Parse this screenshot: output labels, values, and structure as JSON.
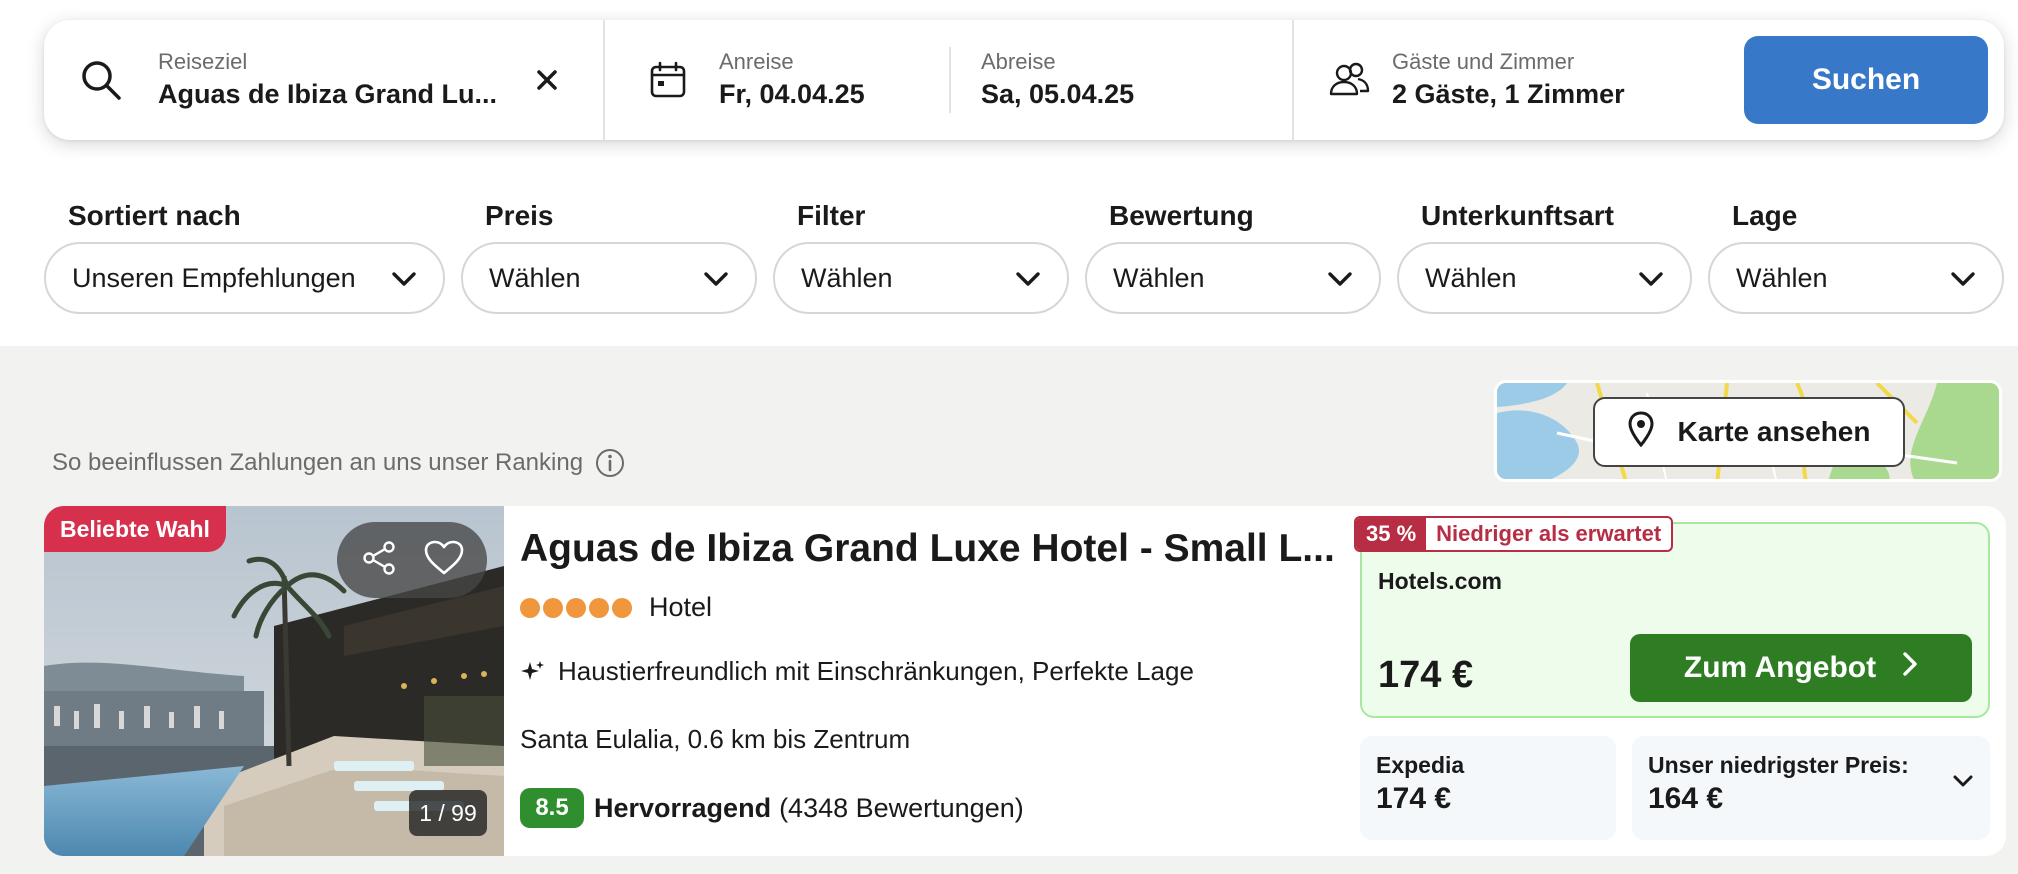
{
  "search": {
    "destination_label": "Reiseziel",
    "destination_value": "Aguas de Ibiza Grand Lu...",
    "checkin_label": "Anreise",
    "checkin_value": "Fr, 04.04.25",
    "checkout_label": "Abreise",
    "checkout_value": "Sa, 05.04.25",
    "guests_label": "Gäste und Zimmer",
    "guests_value": "2 Gäste, 1 Zimmer",
    "search_button": "Suchen"
  },
  "filters": [
    {
      "label": "Sortiert nach",
      "value": "Unseren Empfehlungen"
    },
    {
      "label": "Preis",
      "value": "Wählen"
    },
    {
      "label": "Filter",
      "value": "Wählen"
    },
    {
      "label": "Bewertung",
      "value": "Wählen"
    },
    {
      "label": "Unterkunftsart",
      "value": "Wählen"
    },
    {
      "label": "Lage",
      "value": "Wählen"
    }
  ],
  "results": {
    "ranking_note": "So beeinflussen Zahlungen an uns unser Ranking",
    "map_button": "Karte ansehen"
  },
  "hotel": {
    "badge": "Beliebte Wahl",
    "photo_counter": "1 / 99",
    "name": "Aguas de Ibiza Grand Luxe Hotel - Small L...",
    "stars": 5,
    "type": "Hotel",
    "amenities": "Haustierfreundlich mit Einschränkungen, Perfekte Lage",
    "location": "Santa Eulalia, 0.6 km bis Zentrum",
    "rating_score": "8.5",
    "rating_label": "Hervorragend",
    "rating_count": "(4348 Bewertungen)"
  },
  "offers": {
    "deal_percent": "35 %",
    "deal_text": "Niedriger als erwartet",
    "main_provider": "Hotels.com",
    "main_price": "174 €",
    "main_button": "Zum Angebot",
    "alt_provider": "Expedia",
    "alt_price": "174 €",
    "lowest_label": "Unser niedrigster Preis:",
    "lowest_price": "164 €"
  },
  "colors": {
    "search_button": "#3778c8",
    "badge_popular": "#d6304d",
    "rating": "#2f8f2f",
    "offer_button": "#2e7d23",
    "deal": "#b72e44",
    "star_dots": "#f0963c"
  }
}
